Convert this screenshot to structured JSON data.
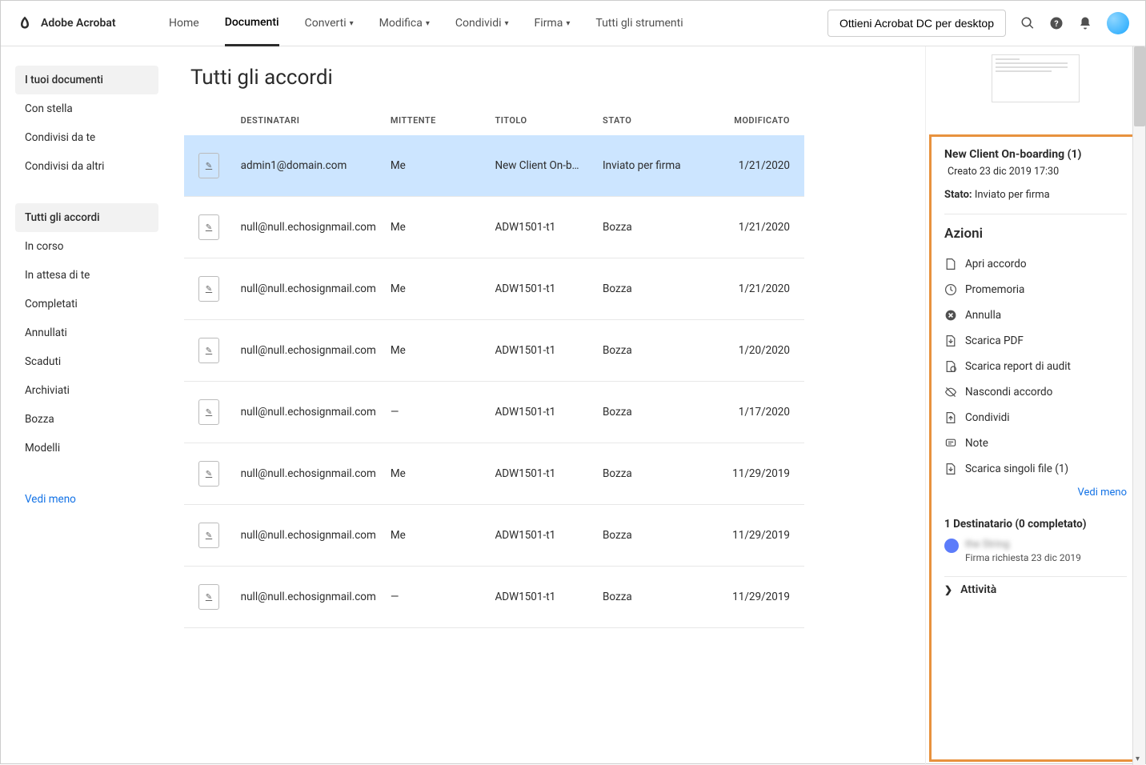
{
  "app": {
    "name": "Adobe Acrobat"
  },
  "nav": {
    "home": "Home",
    "documenti": "Documenti",
    "converti": "Converti",
    "modifica": "Modifica",
    "condividi": "Condividi",
    "firma": "Firma",
    "tutti": "Tutti gli strumenti"
  },
  "header": {
    "desktop_btn": "Ottieni Acrobat DC per desktop"
  },
  "sidebar": {
    "group1": [
      {
        "label": "I tuoi documenti",
        "selected": true
      },
      {
        "label": "Con stella"
      },
      {
        "label": "Condivisi da te"
      },
      {
        "label": "Condivisi da altri"
      }
    ],
    "group2": [
      {
        "label": "Tutti gli accordi",
        "selected": true
      },
      {
        "label": "In corso"
      },
      {
        "label": "In attesa di te"
      },
      {
        "label": "Completati"
      },
      {
        "label": "Annullati"
      },
      {
        "label": "Scaduti"
      },
      {
        "label": "Archiviati"
      },
      {
        "label": "Bozza"
      },
      {
        "label": "Modelli"
      }
    ],
    "vedi_meno": "Vedi meno"
  },
  "page": {
    "title": "Tutti gli accordi"
  },
  "table": {
    "headers": {
      "destinatari": "DESTINATARI",
      "mittente": "MITTENTE",
      "titolo": "TITOLO",
      "stato": "STATO",
      "modificato": "MODIFICATO"
    },
    "rows": [
      {
        "dest": "admin1@domain.com",
        "mitt": "Me",
        "title": "New Client On-b…",
        "stato": "Inviato per firma",
        "mod": "1/21/2020",
        "selected": true
      },
      {
        "dest": "null@null.echosignmail.com",
        "mitt": "Me",
        "title": "ADW1501-t1",
        "stato": "Bozza",
        "mod": "1/21/2020"
      },
      {
        "dest": "null@null.echosignmail.com",
        "mitt": "Me",
        "title": "ADW1501-t1",
        "stato": "Bozza",
        "mod": "1/21/2020"
      },
      {
        "dest": "null@null.echosignmail.com",
        "mitt": "Me",
        "title": "ADW1501-t1",
        "stato": "Bozza",
        "mod": "1/20/2020"
      },
      {
        "dest": "null@null.echosignmail.com",
        "mitt": "—",
        "title": "ADW1501-t1",
        "stato": "Bozza",
        "mod": "1/17/2020"
      },
      {
        "dest": "null@null.echosignmail.com",
        "mitt": "Me",
        "title": "ADW1501-t1",
        "stato": "Bozza",
        "mod": "11/29/2019"
      },
      {
        "dest": "null@null.echosignmail.com",
        "mitt": "Me",
        "title": "ADW1501-t1",
        "stato": "Bozza",
        "mod": "11/29/2019"
      },
      {
        "dest": "null@null.echosignmail.com",
        "mitt": "—",
        "title": "ADW1501-t1",
        "stato": "Bozza",
        "mod": "11/29/2019"
      }
    ]
  },
  "details": {
    "title": "New Client On-boarding (1)",
    "created": "Creato 23 dic 2019 17:30",
    "state_label": "Stato:",
    "state_value": "Inviato per firma",
    "actions_title": "Azioni",
    "actions": [
      {
        "icon": "file",
        "label": "Apri accordo"
      },
      {
        "icon": "clock",
        "label": "Promemoria"
      },
      {
        "icon": "cancel",
        "label": "Annulla"
      },
      {
        "icon": "download",
        "label": "Scarica PDF"
      },
      {
        "icon": "report",
        "label": "Scarica report di audit"
      },
      {
        "icon": "hide",
        "label": "Nascondi accordo"
      },
      {
        "icon": "share",
        "label": "Condividi"
      },
      {
        "icon": "note",
        "label": "Note"
      },
      {
        "icon": "files",
        "label": "Scarica singoli file (1)"
      }
    ],
    "vedi_meno": "Vedi meno",
    "recipient_title": "1 Destinatario (0 completato)",
    "recipient_name": "the String",
    "recipient_sub": "Firma richiesta 23 dic 2019",
    "activity": "Attività"
  }
}
